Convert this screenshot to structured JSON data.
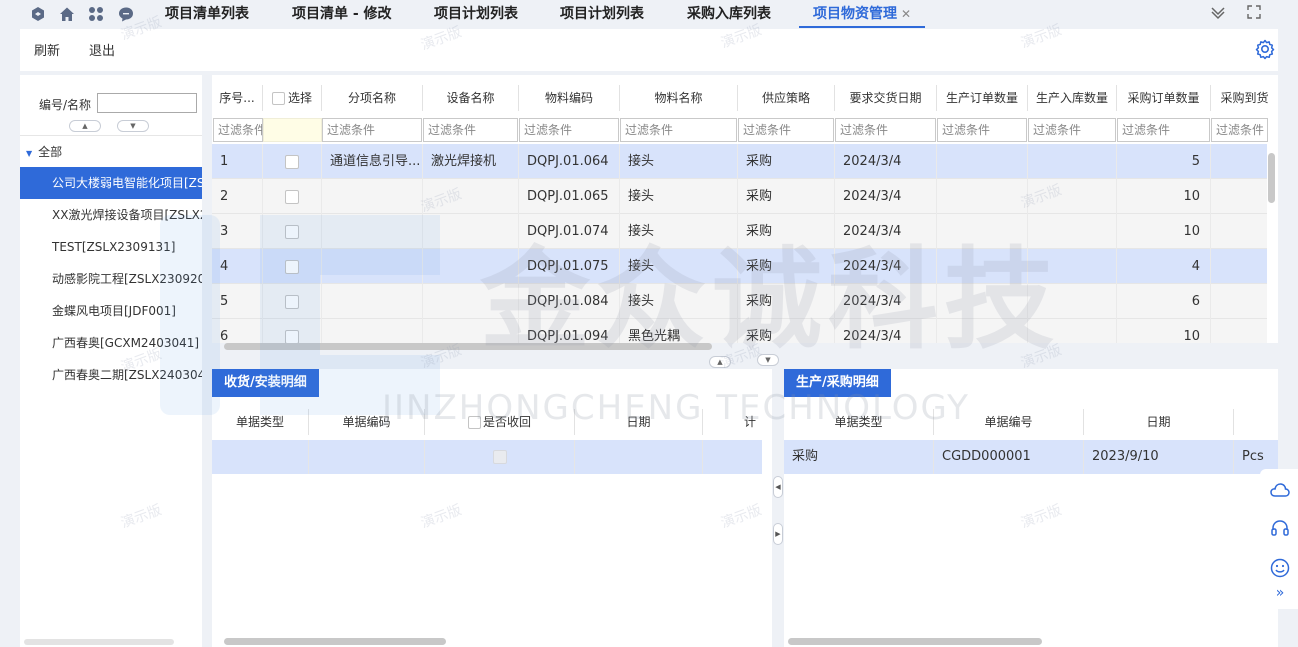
{
  "tabs": [
    {
      "label": "项目清单列表",
      "active": false
    },
    {
      "label": "项目清单 - 修改",
      "active": false
    },
    {
      "label": "项目计划列表",
      "active": false
    },
    {
      "label": "项目计划列表",
      "active": false
    },
    {
      "label": "采购入库列表",
      "active": false
    },
    {
      "label": "项目物资管理",
      "active": true
    }
  ],
  "toolbar": {
    "refresh": "刷新",
    "exit": "退出"
  },
  "search": {
    "label": "编号/名称",
    "value": ""
  },
  "tree": {
    "root": "全部",
    "items": [
      "公司大楼弱电智能化项目[ZS",
      "XX激光焊接设备项目[ZSLX2",
      "TEST[ZSLX2309131]",
      "动感影院工程[ZSLX2309201",
      "金蝶风电项目[JDF001]",
      "广西春奥[GCXM2403041]",
      "广西春奥二期[ZSLX240304"
    ],
    "selected_index": 0
  },
  "grid": {
    "columns": [
      "序号...",
      "选择",
      "分项名称",
      "设备名称",
      "物料编码",
      "物料名称",
      "供应策略",
      "要求交货日期",
      "生产订单数量",
      "生产入库数量",
      "采购订单数量",
      "采购到货"
    ],
    "filter_placeholder": "过滤条件",
    "rows": [
      {
        "no": "1",
        "item": "通道信息引导...",
        "device": "激光焊接机",
        "code": "DQPJ.01.064",
        "material": "接头",
        "strategy": "采购",
        "date": "2024/3/4",
        "po_qty": "5"
      },
      {
        "no": "2",
        "item": "",
        "device": "",
        "code": "DQPJ.01.065",
        "material": "接头",
        "strategy": "采购",
        "date": "2024/3/4",
        "po_qty": "10"
      },
      {
        "no": "3",
        "item": "",
        "device": "",
        "code": "DQPJ.01.074",
        "material": "接头",
        "strategy": "采购",
        "date": "2024/3/4",
        "po_qty": "10"
      },
      {
        "no": "4",
        "item": "",
        "device": "",
        "code": "DQPJ.01.075",
        "material": "接头",
        "strategy": "采购",
        "date": "2024/3/4",
        "po_qty": "4"
      },
      {
        "no": "5",
        "item": "",
        "device": "",
        "code": "DQPJ.01.084",
        "material": "接头",
        "strategy": "采购",
        "date": "2024/3/4",
        "po_qty": "6"
      },
      {
        "no": "6",
        "item": "",
        "device": "",
        "code": "DQPJ.01.094",
        "material": "黑色光耦",
        "strategy": "采购",
        "date": "2024/3/4",
        "po_qty": "10"
      }
    ]
  },
  "receive_panel": {
    "title": "收货/安装明细",
    "columns": [
      "单据类型",
      "单据编码",
      "是否收回",
      "日期",
      "计"
    ]
  },
  "purchase_panel": {
    "title": "生产/采购明细",
    "columns": [
      "单据类型",
      "单据编号",
      "日期"
    ],
    "rows": [
      {
        "type": "采购",
        "code": "CGDD000001",
        "date": "2023/9/10",
        "unit": "Pcs"
      }
    ]
  },
  "watermark": {
    "text": "演示版",
    "brand": "金众诚科技",
    "brand_en": "JINZHONGCHENG TECHNOLOGY"
  },
  "colors": {
    "accent": "#2f6ad9",
    "highlight_row": "#d8e3fb"
  }
}
